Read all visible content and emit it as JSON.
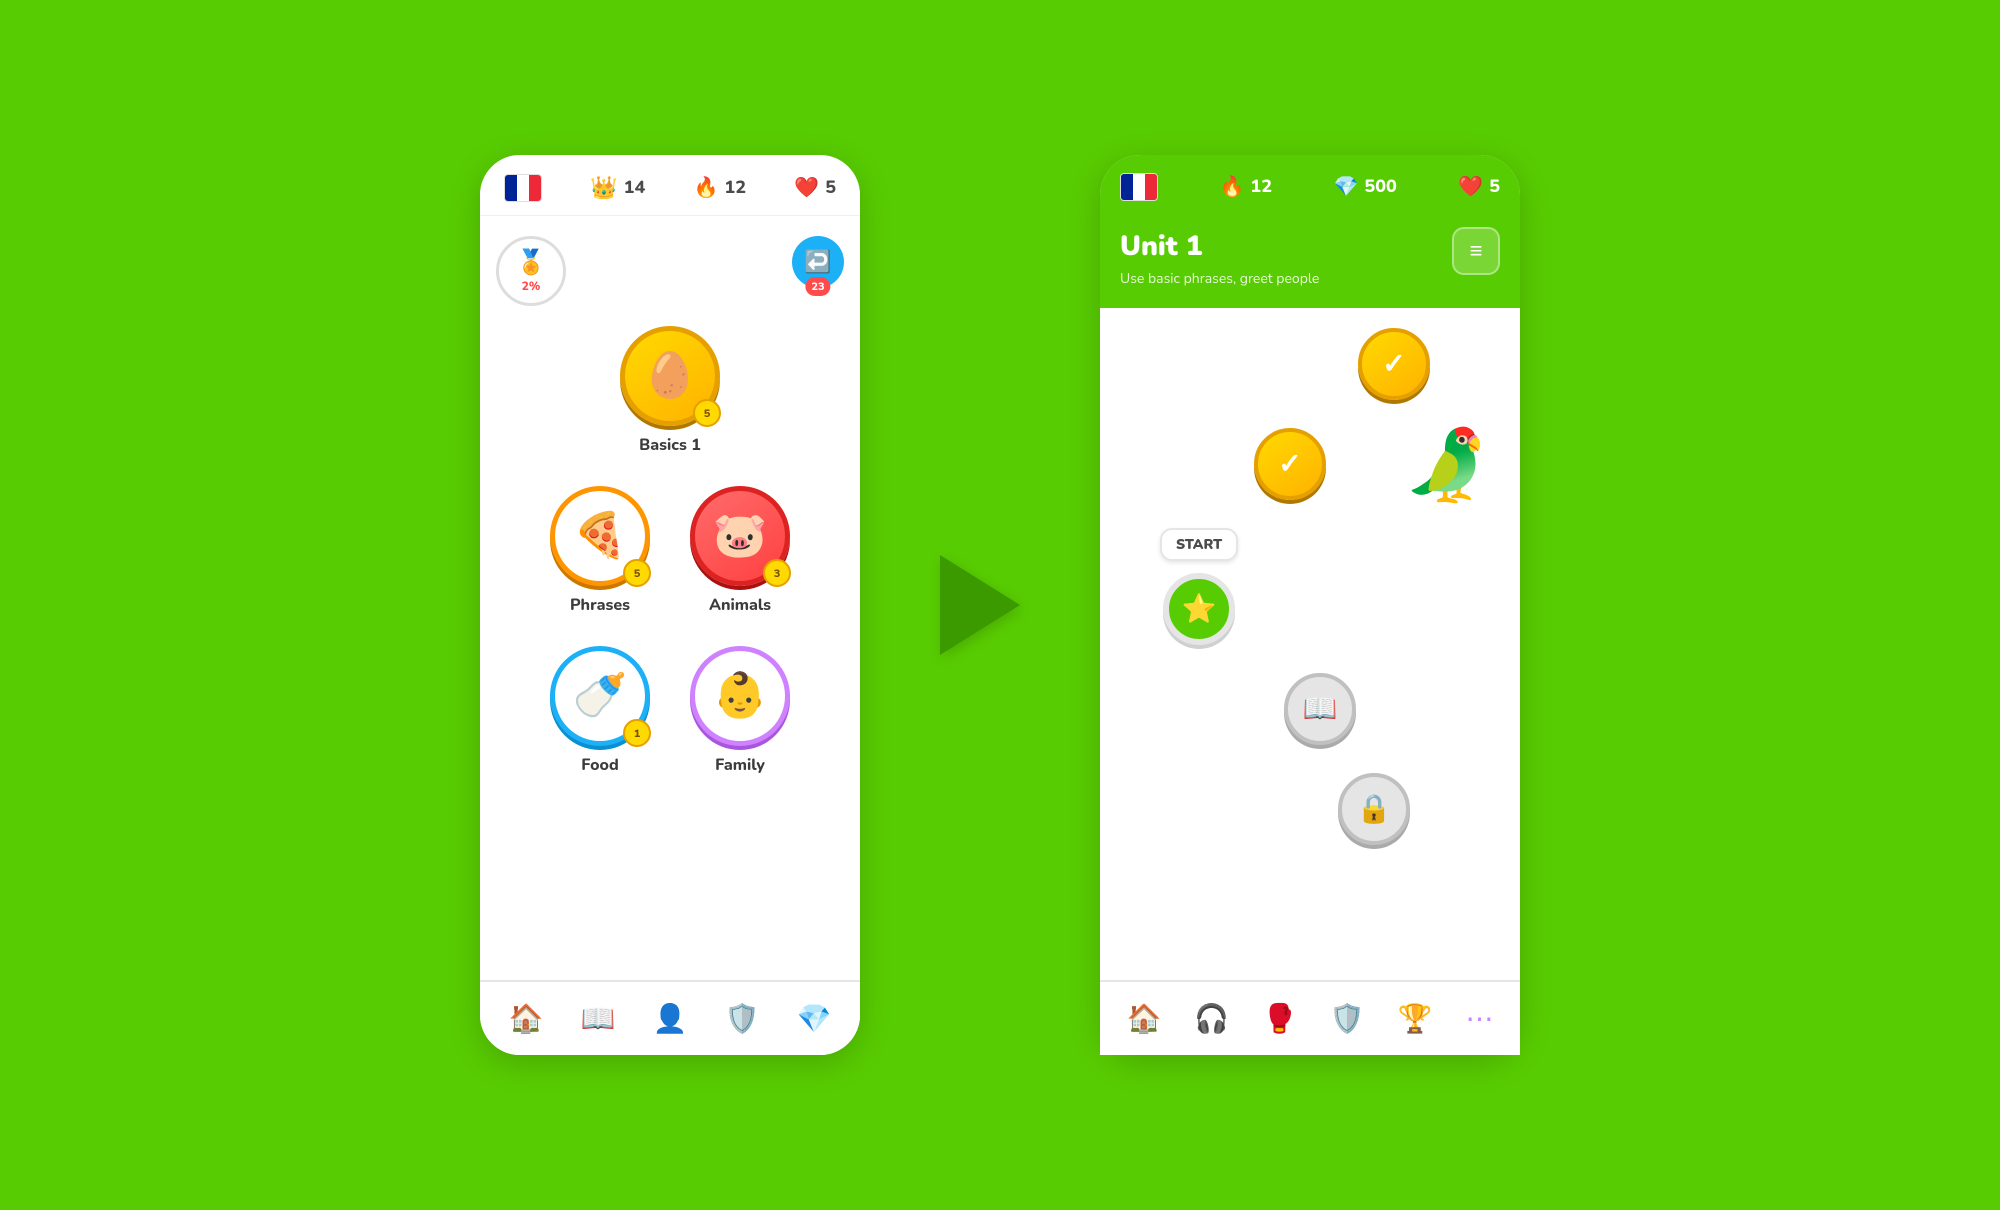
{
  "background_color": "#58cc02",
  "left_phone": {
    "header": {
      "crown_value": "14",
      "fire_value": "12",
      "heart_value": "5",
      "streak_badge": "23",
      "profile_percent": "2%"
    },
    "lessons": [
      {
        "id": "basics1",
        "label": "Basics 1",
        "style": "gold",
        "badge": "5",
        "emoji": "🥚",
        "row": "center",
        "offset": 0
      },
      {
        "id": "phrases",
        "label": "Phrases",
        "style": "orange-outline",
        "badge": "5",
        "emoji": "🍕",
        "row": "left"
      },
      {
        "id": "animals",
        "label": "Animals",
        "style": "red-filled",
        "badge": "3",
        "emoji": "🐷",
        "row": "right"
      },
      {
        "id": "food",
        "label": "Food",
        "style": "blue-outline",
        "badge": "1",
        "emoji": "🍼",
        "row": "left"
      },
      {
        "id": "family",
        "label": "Family",
        "style": "purple-outline",
        "badge": "",
        "emoji": "👶",
        "row": "right"
      }
    ],
    "bottom_nav": [
      {
        "id": "home",
        "icon": "🏠",
        "active": true
      },
      {
        "id": "learn",
        "icon": "📖",
        "active": false
      },
      {
        "id": "people",
        "icon": "👤",
        "active": false
      },
      {
        "id": "shield",
        "icon": "🛡️",
        "active": false
      },
      {
        "id": "gems",
        "icon": "💎",
        "active": false
      }
    ]
  },
  "right_phone": {
    "header": {
      "fire_value": "12",
      "gem_value": "500",
      "heart_value": "5"
    },
    "unit": {
      "title": "Unit 1",
      "subtitle": "Use basic phrases, greet people"
    },
    "path_nodes": [
      {
        "id": "node1",
        "style": "completed",
        "offset": "right",
        "show_start": false
      },
      {
        "id": "node2",
        "style": "completed",
        "offset": "left",
        "show_start": false
      },
      {
        "id": "node3",
        "style": "start",
        "offset": "left",
        "show_start": true
      },
      {
        "id": "node4",
        "style": "locked",
        "offset": "right",
        "show_start": false
      },
      {
        "id": "node5",
        "style": "locked",
        "offset": "right",
        "show_start": false
      }
    ],
    "start_label": "START",
    "bottom_nav": [
      {
        "id": "home",
        "icon": "🏠",
        "active": true
      },
      {
        "id": "headphones",
        "icon": "🎧",
        "active": false
      },
      {
        "id": "dumbbell",
        "icon": "🥊",
        "active": false
      },
      {
        "id": "shield",
        "icon": "🛡️",
        "active": false
      },
      {
        "id": "trophy",
        "icon": "🏆",
        "active": false
      },
      {
        "id": "more",
        "icon": "⋯",
        "active": false
      }
    ]
  },
  "arrow": "➡"
}
